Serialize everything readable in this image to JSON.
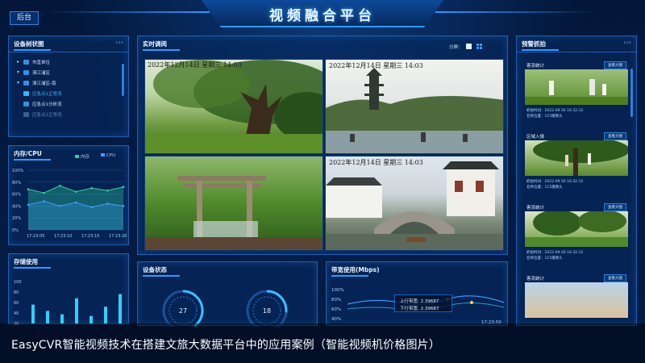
{
  "header": {
    "title": "视频融合平台",
    "back_label": "后台"
  },
  "device_tree": {
    "title": "设备树状图",
    "items": [
      {
        "label": "市直单位",
        "state": "normal"
      },
      {
        "label": "清江浦区",
        "state": "normal"
      },
      {
        "label": "清江浦区-南",
        "state": "normal"
      },
      {
        "label": "应急点1正常流",
        "state": "active"
      },
      {
        "label": "应急点1分析流",
        "state": "normal"
      },
      {
        "label": "应急点2正常流",
        "state": "dim"
      }
    ]
  },
  "cpu_panel": {
    "title": "内存/CPU",
    "legend": [
      "内存",
      "CPU"
    ],
    "y_ticks": [
      "100%",
      "80%",
      "60%",
      "40%",
      "20%",
      "0%"
    ],
    "x_ticks": [
      "17:23:05",
      "17:23:10",
      "17:23:15",
      "17:23:20"
    ]
  },
  "storage_panel": {
    "title": "存储使用",
    "y_ticks": [
      "100",
      "80",
      "60",
      "40",
      "20"
    ]
  },
  "video": {
    "title": "实时调阅",
    "split_label": "分屏：",
    "timestamps": [
      "2022年12月14日 星期三 14:03",
      "2022年12月14日 星期三 14:03",
      "",
      "2022年12月14日 星期三 14:03"
    ]
  },
  "device_status": {
    "title": "设备状态",
    "values": [
      "27",
      "18"
    ]
  },
  "bandwidth": {
    "title": "带宽使用(Mbps)",
    "y_ticks": [
      "100%",
      "80%",
      "60%",
      "40%"
    ],
    "tooltip_up": "上行带宽:  2.39687",
    "tooltip_down": "下行带宽:  2.39687",
    "x_tick": "17:23:50"
  },
  "captures": {
    "title": "预警抓拍",
    "items": [
      {
        "label": "客流统计",
        "button": "查看大图",
        "time": "抓拍时间：2022-09-30 16:32:12",
        "name": "名称位置：115摄像头"
      },
      {
        "label": "区域入侵",
        "button": "查看大图",
        "time": "抓拍时间：2022-09-30 16:32:12",
        "name": "名称位置：115摄像头"
      },
      {
        "label": "客流统计",
        "button": "查看大图",
        "time": "抓拍时间：2022-09-30 16:32:12",
        "name": "名称位置：115摄像头"
      },
      {
        "label": "客流统计",
        "button": "查看大图",
        "time": "",
        "name": ""
      }
    ]
  },
  "caption": "EasyCVR智能视频技术在搭建文旅大数据平台中的应用案例（智能视频机价格图片）",
  "chart_data": [
    {
      "type": "line",
      "title": "内存/CPU",
      "categories": [
        "17:23:05",
        "17:23:10",
        "17:23:15",
        "17:23:20"
      ],
      "series": [
        {
          "name": "内存",
          "values": [
            68,
            62,
            74,
            64,
            70,
            66,
            72
          ]
        },
        {
          "name": "CPU",
          "values": [
            42,
            48,
            40,
            46,
            38,
            44,
            40
          ]
        }
      ],
      "ylim": [
        0,
        100
      ],
      "colors": [
        "#2fd0a0",
        "#3aa0ff"
      ]
    },
    {
      "type": "bar",
      "title": "存储使用",
      "values": [
        45,
        30,
        22,
        60,
        18,
        40,
        70
      ],
      "ylim": [
        0,
        100
      ],
      "colors": [
        "#2fd0ff"
      ]
    }
  ]
}
